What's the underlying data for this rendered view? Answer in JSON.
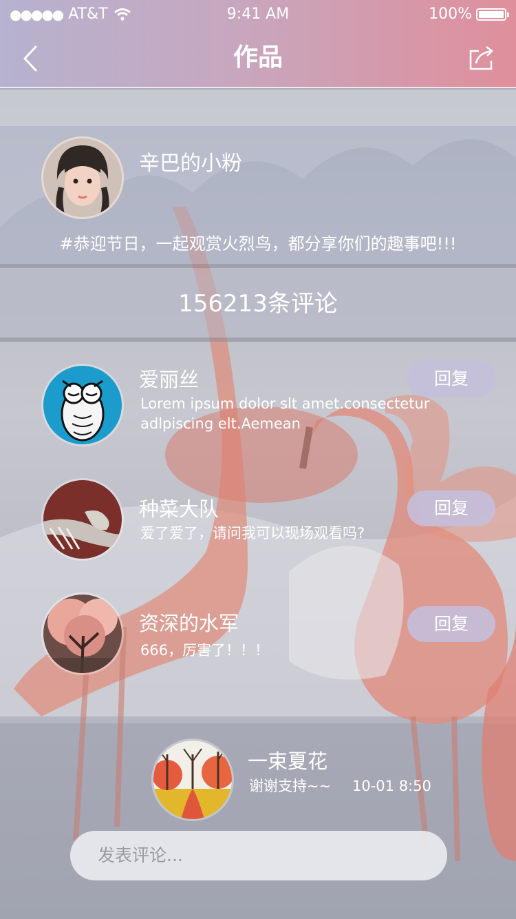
{
  "status_bar": {
    "carrier": "AT&T",
    "time": "9:41 AM",
    "battery": "100%"
  },
  "nav": {
    "title": "作品",
    "back_icon": "chevron-left-icon",
    "share_icon": "share-icon"
  },
  "post": {
    "author": "辛巴的小粉",
    "text": "#恭迎节日，一起观赏火烈鸟，都分享你们的趣事吧!!!"
  },
  "comment_count": "156213条评论",
  "comments": [
    {
      "name": "爱丽丝",
      "text": "Lorem ipsum dolor slt amet.consectetur adlpiscing elt.Aemean",
      "reply": "回复"
    },
    {
      "name": "种菜大队",
      "text": "爱了爱了，请问我可以现场观看吗?",
      "reply": "回复"
    },
    {
      "name": "资深的水军",
      "text": "666，厉害了！！！",
      "reply": "回复"
    }
  ],
  "pinned_reply": {
    "name": "一束夏花",
    "text": "谢谢支持~~",
    "time": "10-01 8:50"
  },
  "input": {
    "placeholder": "发表评论..."
  },
  "colors": {
    "reply_button": "#c4bfda",
    "nav_start": "#b6b2cf",
    "nav_end": "#df8f9b"
  }
}
